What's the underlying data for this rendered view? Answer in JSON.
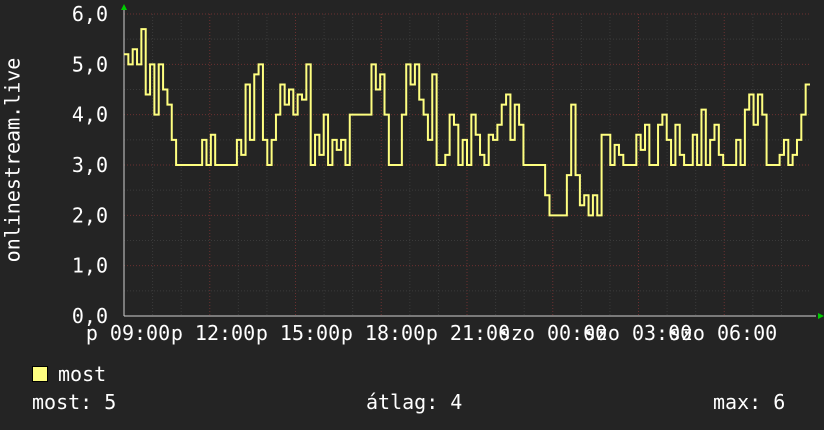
{
  "chart_data": {
    "type": "line",
    "ylabel": "onlinestream.live",
    "y_ticks": [
      "0,0",
      "1,0",
      "2,0",
      "3,0",
      "4,0",
      "5,0",
      "6,0"
    ],
    "ylim": [
      0,
      6
    ],
    "x_ticks": [
      "p 09:00",
      "p 12:00",
      "p 15:00",
      "p 18:00",
      "p 21:00",
      "szo 00:00",
      "szo 03:00",
      "szo 06:00"
    ],
    "grid": true,
    "series": [
      {
        "name": "most",
        "color": "#ffff80",
        "values": [
          5.2,
          5.0,
          5.3,
          5.0,
          5.7,
          4.4,
          5.0,
          4.0,
          5.0,
          4.5,
          4.2,
          3.5,
          3.0,
          3.0,
          3.0,
          3.0,
          3.0,
          3.0,
          3.5,
          3.0,
          3.6,
          3.0,
          3.0,
          3.0,
          3.0,
          3.0,
          3.5,
          3.2,
          4.6,
          3.5,
          4.8,
          5.0,
          3.5,
          3.0,
          3.5,
          4.0,
          4.6,
          4.2,
          4.5,
          4.0,
          4.4,
          4.3,
          5.0,
          3.0,
          3.6,
          3.2,
          4.0,
          3.0,
          3.5,
          3.3,
          3.5,
          3.0,
          4.0,
          4.0,
          4.0,
          4.0,
          4.0,
          5.0,
          4.5,
          4.8,
          4.0,
          3.0,
          3.0,
          3.0,
          4.0,
          5.0,
          4.6,
          5.0,
          4.3,
          4.0,
          3.5,
          4.8,
          3.0,
          3.0,
          3.2,
          4.0,
          3.8,
          3.0,
          3.5,
          3.0,
          4.0,
          3.6,
          3.2,
          3.0,
          3.6,
          3.5,
          3.8,
          4.2,
          4.4,
          3.5,
          4.2,
          3.8,
          3.0,
          3.0,
          3.0,
          3.0,
          3.0,
          2.4,
          2.0,
          2.0,
          2.0,
          2.0,
          2.8,
          4.2,
          2.8,
          2.2,
          2.4,
          2.0,
          2.4,
          2.0,
          3.6,
          3.6,
          3.0,
          3.4,
          3.2,
          3.0,
          3.0,
          3.0,
          3.6,
          3.3,
          3.8,
          3.0,
          3.0,
          3.8,
          4.0,
          3.5,
          3.0,
          3.8,
          3.2,
          3.0,
          3.0,
          3.6,
          3.0,
          4.1,
          3.0,
          3.5,
          3.8,
          3.2,
          3.0,
          3.0,
          3.0,
          3.5,
          3.0,
          4.1,
          4.4,
          3.8,
          4.4,
          4.0,
          3.0,
          3.0,
          3.0,
          3.2,
          3.5,
          3.0,
          3.2,
          3.5,
          4.0,
          4.6
        ]
      }
    ]
  },
  "legend": {
    "items": [
      {
        "label": "most",
        "color": "#ffff80"
      }
    ]
  },
  "stats": {
    "current": "most: 5",
    "average": "átlag: 4",
    "max": "max: 6"
  }
}
